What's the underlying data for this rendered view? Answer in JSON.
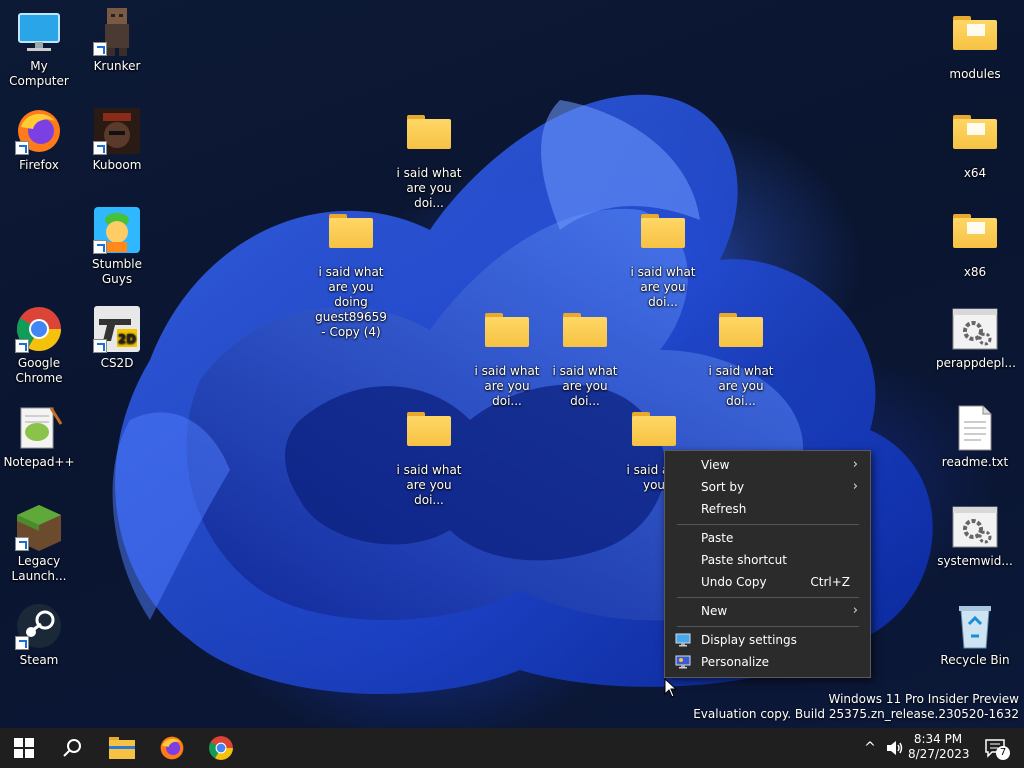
{
  "desktop": {
    "icons_left": [
      {
        "label": "My Computer",
        "icon": "monitor-icon"
      },
      {
        "label": "Krunker",
        "icon": "krunker-icon"
      },
      {
        "label": "Firefox",
        "icon": "firefox-icon"
      },
      {
        "label": "Kuboom",
        "icon": "kuboom-icon"
      },
      {
        "label": "Stumble Guys",
        "icon": "stumble-guys-icon"
      },
      {
        "label": "Google Chrome",
        "icon": "chrome-icon"
      },
      {
        "label": "CS2D",
        "icon": "cs2d-icon"
      },
      {
        "label": "Notepad++",
        "icon": "notepad-plus-plus-icon"
      },
      {
        "label": "Legacy Launch...",
        "icon": "minecraft-grass-icon"
      },
      {
        "label": "Steam",
        "icon": "steam-icon"
      }
    ],
    "icons_right": [
      {
        "label": "modules",
        "icon": "folder-icon"
      },
      {
        "label": "x64",
        "icon": "folder-icon"
      },
      {
        "label": "x86",
        "icon": "folder-icon"
      },
      {
        "label": "perappdepl...",
        "icon": "settings-file-icon"
      },
      {
        "label": "readme.txt",
        "icon": "text-file-icon"
      },
      {
        "label": "systemwid...",
        "icon": "settings-file-icon"
      },
      {
        "label": "Recycle Bin",
        "icon": "recycle-bin-icon"
      }
    ],
    "folders": [
      {
        "label": "i said what are you doi..."
      },
      {
        "label": "i said what are you doing guest89659 - Copy (4)"
      },
      {
        "label": "i said what are you doi..."
      },
      {
        "label": "i said what are you doi..."
      },
      {
        "label": "i said what are you doi..."
      },
      {
        "label": "i said what are you doi..."
      },
      {
        "label": "i said what are you doi..."
      },
      {
        "label": "i said are you"
      }
    ]
  },
  "context_menu": {
    "items": [
      {
        "label": "View",
        "submenu": true
      },
      {
        "label": "Sort by",
        "submenu": true
      },
      {
        "label": "Refresh"
      },
      {
        "label": "Paste"
      },
      {
        "label": "Paste shortcut"
      },
      {
        "label": "Undo Copy",
        "shortcut": "Ctrl+Z"
      },
      {
        "label": "New",
        "submenu": true
      },
      {
        "label": "Display settings",
        "icon": "display-icon"
      },
      {
        "label": "Personalize",
        "icon": "personalize-icon"
      }
    ],
    "submenu_arrow": "›"
  },
  "watermark": {
    "line1": "Windows 11 Pro Insider Preview",
    "line2": "Evaluation copy. Build 25375.zn_release.230520-1632"
  },
  "taskbar": {
    "buttons": [
      "start-icon",
      "search-icon",
      "file-explorer-icon",
      "firefox-icon",
      "chrome-icon"
    ],
    "clock_time": "8:34 PM",
    "clock_date": "8/27/2023",
    "notification_count": "7",
    "chevron": "^"
  },
  "colors": {
    "taskbar": "#1f1f1f",
    "menu": "#2b2b2b",
    "folder": "#f6c243",
    "accent": "#1a6fd6"
  }
}
